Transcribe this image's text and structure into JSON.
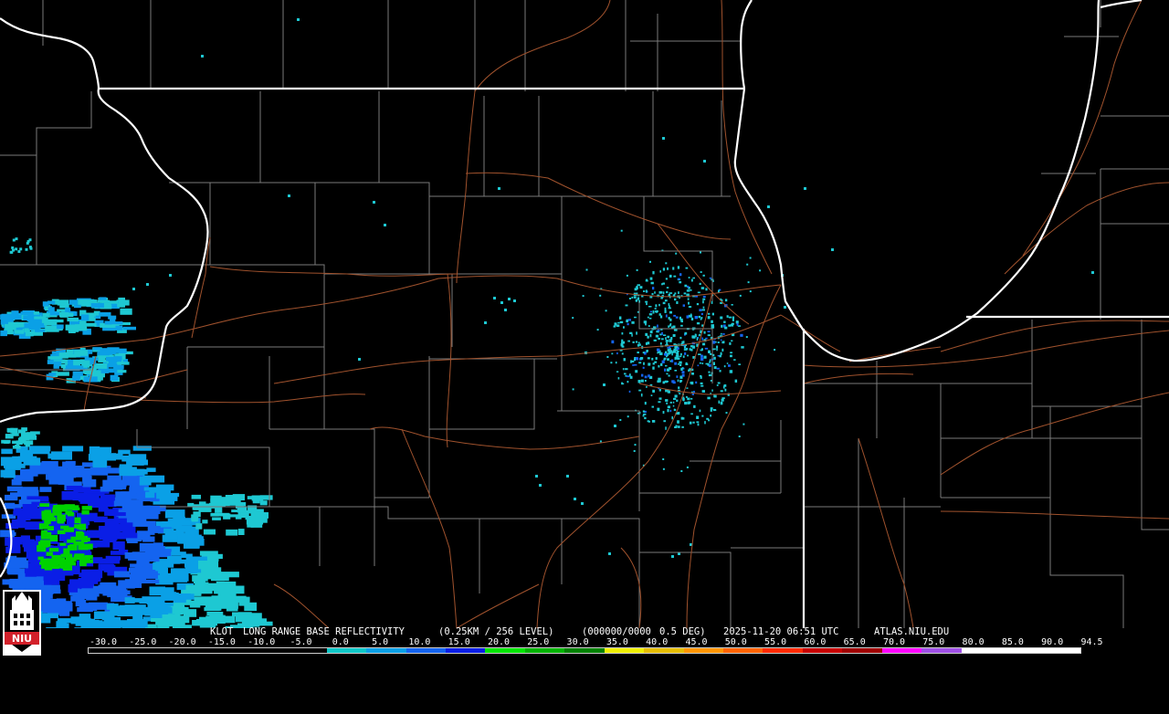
{
  "product": {
    "station": "KLOT",
    "product_name": "LONG RANGE BASE REFLECTIVITY",
    "resolution": "(0.25KM / 256 LEVEL)",
    "code": "(000000/0000",
    "tilt": "0.5 DEG)",
    "timestamp": "2025-11-20 06:51 UTC",
    "source": "ATLAS.NIU.EDU"
  },
  "logo": {
    "text": "NIU",
    "background": "#d3202a"
  },
  "scale": {
    "labels": [
      "-30.0",
      "-25.0",
      "-20.0",
      "-15.0",
      "-10.0",
      "-5.0",
      "0.0",
      "5.0",
      "10.0",
      "15.0",
      "20.0",
      "25.0",
      "30.0",
      "35.0",
      "40.0",
      "45.0",
      "50.0",
      "55.0",
      "60.0",
      "65.0",
      "70.0",
      "75.0",
      "80.0",
      "85.0",
      "90.0",
      "94.5"
    ],
    "colors": [
      "#000000",
      "#000000",
      "#000000",
      "#000000",
      "#000000",
      "#000000",
      "#0fc8c8",
      "#0aa0e6",
      "#1464f0",
      "#0a1ee6",
      "#00e600",
      "#00b400",
      "#008200",
      "#f0f000",
      "#e6be00",
      "#ff9600",
      "#ff6400",
      "#ff2a00",
      "#c80000",
      "#a00000",
      "#ff00ff",
      "#a050e6",
      "#ffffff",
      "#ffffff",
      "#ffffff"
    ]
  },
  "colors": {
    "state_border": "#ffffff",
    "county_border": "#7a7a7a",
    "highway": "#a0522d",
    "background": "#000000"
  }
}
